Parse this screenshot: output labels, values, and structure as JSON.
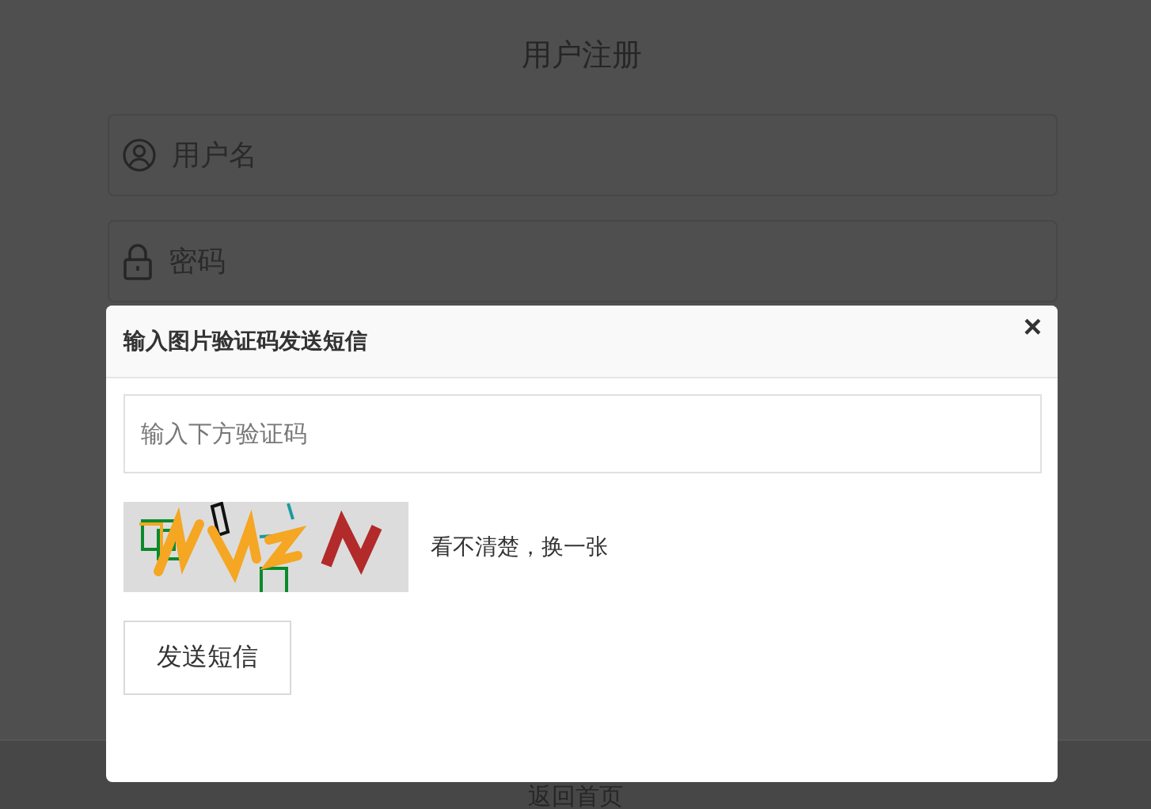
{
  "page": {
    "title": "用户注册",
    "fields": [
      {
        "kind": "user",
        "placeholder": "用户名"
      },
      {
        "kind": "lock",
        "placeholder": "密码"
      }
    ],
    "footer_link": "返回首页"
  },
  "dialog": {
    "title": "输入图片验证码发送短信",
    "close": "×",
    "code_field": {
      "placeholder": "输入下方验证码"
    },
    "refresh_link": "看不清楚，换一张",
    "send_button": "发送短信"
  }
}
